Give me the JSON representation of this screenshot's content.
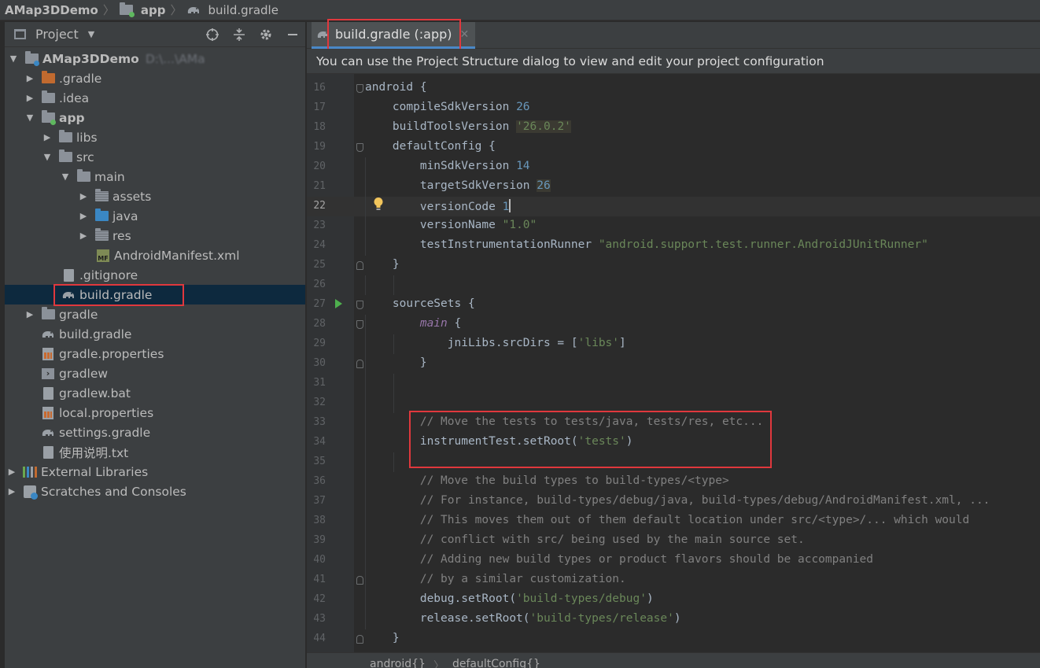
{
  "breadcrumb": {
    "items": [
      "AMap3DDemo",
      "app",
      "build.gradle"
    ]
  },
  "project_panel": {
    "title": "Project",
    "tree": [
      {
        "label": "AMap3DDemo",
        "suffix": "D:\\...\\AMa",
        "icon": "module-folder-icon",
        "arrow": "down",
        "bold": true
      },
      {
        "label": ".gradle",
        "icon": "folder-icon",
        "arrow": "right"
      },
      {
        "label": ".idea",
        "icon": "folder-icon",
        "arrow": "right"
      },
      {
        "label": "app",
        "icon": "module-folder-icon",
        "arrow": "down",
        "bold": true
      },
      {
        "label": "libs",
        "icon": "folder-icon",
        "arrow": "right"
      },
      {
        "label": "src",
        "icon": "folder-icon",
        "arrow": "down"
      },
      {
        "label": "main",
        "icon": "folder-icon",
        "arrow": "down"
      },
      {
        "label": "assets",
        "icon": "resources-folder-icon",
        "arrow": "right"
      },
      {
        "label": "java",
        "icon": "source-folder-icon",
        "arrow": "right"
      },
      {
        "label": "res",
        "icon": "resources-folder-icon",
        "arrow": "right"
      },
      {
        "label": "AndroidManifest.xml",
        "icon": "manifest-file-icon"
      },
      {
        "label": ".gitignore",
        "icon": "gitignore-file-icon"
      },
      {
        "label": "build.gradle",
        "icon": "gradle-file-icon",
        "selected": true
      },
      {
        "label": "gradle",
        "icon": "folder-icon",
        "arrow": "right"
      },
      {
        "label": "build.gradle",
        "icon": "gradle-file-icon"
      },
      {
        "label": "gradle.properties",
        "icon": "properties-file-icon"
      },
      {
        "label": "gradlew",
        "icon": "terminal-file-icon"
      },
      {
        "label": "gradlew.bat",
        "icon": "text-file-icon"
      },
      {
        "label": "local.properties",
        "icon": "properties-file-icon"
      },
      {
        "label": "settings.gradle",
        "icon": "gradle-file-icon"
      },
      {
        "label": "使用说明.txt",
        "icon": "text-file-icon"
      },
      {
        "label": "External Libraries",
        "icon": "libraries-icon",
        "arrow": "right"
      },
      {
        "label": "Scratches and Consoles",
        "icon": "scratches-icon",
        "arrow": "right"
      }
    ]
  },
  "editor": {
    "tab_label": "build.gradle (:app)",
    "notice": "You can use the Project Structure dialog to view and edit your project configuration",
    "current_line": 22,
    "lines": [
      {
        "n": "16",
        "text": "android {"
      },
      {
        "n": "17",
        "text": "    compileSdkVersion 26"
      },
      {
        "n": "18",
        "text": "    buildToolsVersion '26.0.2'"
      },
      {
        "n": "19",
        "text": "    defaultConfig {"
      },
      {
        "n": "20",
        "text": "        minSdkVersion 14"
      },
      {
        "n": "21",
        "text": "        targetSdkVersion 26"
      },
      {
        "n": "22",
        "text": "        versionCode 1"
      },
      {
        "n": "23",
        "text": "        versionName \"1.0\""
      },
      {
        "n": "24",
        "text": "        testInstrumentationRunner \"android.support.test.runner.AndroidJUnitRunner\""
      },
      {
        "n": "25",
        "text": "    }"
      },
      {
        "n": "26",
        "text": ""
      },
      {
        "n": "27",
        "text": "    sourceSets {"
      },
      {
        "n": "28",
        "text": "        main {"
      },
      {
        "n": "29",
        "text": "            jniLibs.srcDirs = ['libs']"
      },
      {
        "n": "30",
        "text": "        }"
      },
      {
        "n": "31",
        "text": ""
      },
      {
        "n": "32",
        "text": ""
      },
      {
        "n": "33",
        "text": "        // Move the tests to tests/java, tests/res, etc..."
      },
      {
        "n": "34",
        "text": "        instrumentTest.setRoot('tests')"
      },
      {
        "n": "35",
        "text": ""
      },
      {
        "n": "36",
        "text": "        // Move the build types to build-types/<type>"
      },
      {
        "n": "37",
        "text": "        // For instance, build-types/debug/java, build-types/debug/AndroidManifest.xml, ..."
      },
      {
        "n": "38",
        "text": "        // This moves them out of them default location under src/<type>/... which would"
      },
      {
        "n": "39",
        "text": "        // conflict with src/ being used by the main source set."
      },
      {
        "n": "40",
        "text": "        // Adding new build types or product flavors should be accompanied"
      },
      {
        "n": "41",
        "text": "        // by a similar customization."
      },
      {
        "n": "42",
        "text": "        debug.setRoot('build-types/debug')"
      },
      {
        "n": "43",
        "text": "        release.setRoot('build-types/release')"
      },
      {
        "n": "44",
        "text": "    }"
      }
    ]
  },
  "statusbar": {
    "items": [
      "android{}",
      "defaultConfig{}"
    ]
  },
  "colors": {
    "highlight_box": "#e0383d",
    "selection": "#0d293e",
    "tab_underline": "#4a88c7"
  }
}
